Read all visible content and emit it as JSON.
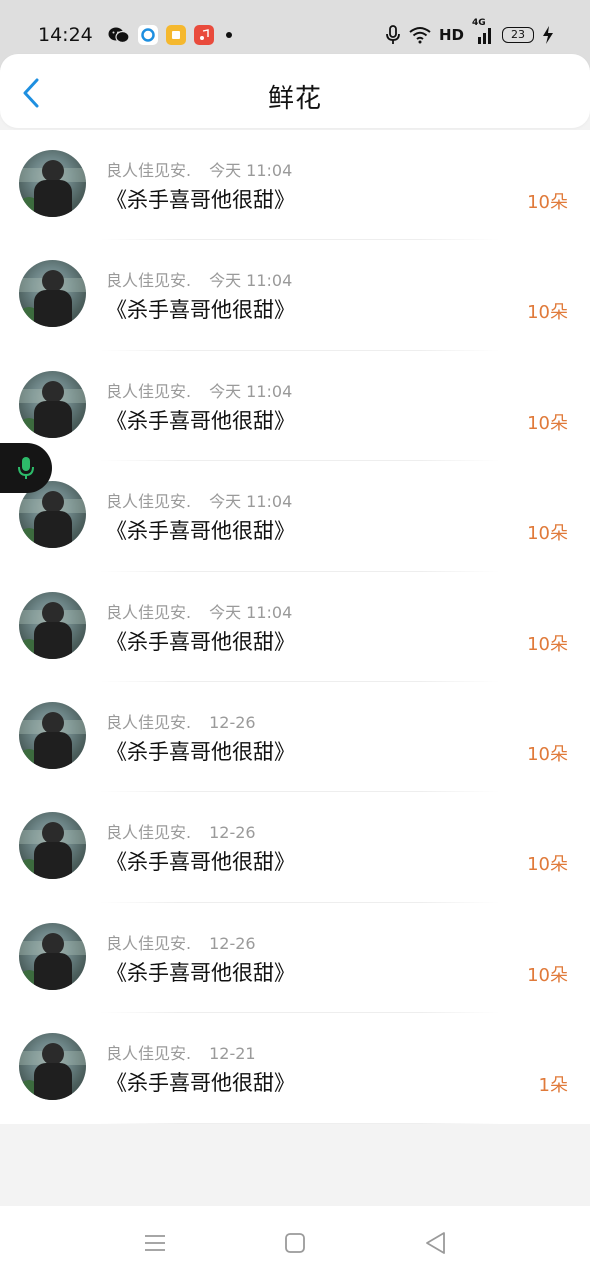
{
  "status_bar": {
    "time": "14:24",
    "network": "HD",
    "signal": "4G",
    "battery": "23",
    "icons": [
      "wechat-icon",
      "qq-browser-icon",
      "books-icon",
      "music-icon",
      "dot-icon",
      "mic-icon",
      "wifi-icon",
      "signal-icon",
      "battery-icon",
      "charging-icon"
    ]
  },
  "header": {
    "title": "鲜花",
    "back_icon": "chevron-left-icon"
  },
  "list": [
    {
      "user": "良人佳见安.",
      "time": "今天 11:04",
      "book": "《杀手喜哥他很甜》",
      "amount": "10朵"
    },
    {
      "user": "良人佳见安.",
      "time": "今天 11:04",
      "book": "《杀手喜哥他很甜》",
      "amount": "10朵"
    },
    {
      "user": "良人佳见安.",
      "time": "今天 11:04",
      "book": "《杀手喜哥他很甜》",
      "amount": "10朵"
    },
    {
      "user": "良人佳见安.",
      "time": "今天 11:04",
      "book": "《杀手喜哥他很甜》",
      "amount": "10朵"
    },
    {
      "user": "良人佳见安.",
      "time": "今天 11:04",
      "book": "《杀手喜哥他很甜》",
      "amount": "10朵"
    },
    {
      "user": "良人佳见安.",
      "time": "12-26",
      "book": "《杀手喜哥他很甜》",
      "amount": "10朵"
    },
    {
      "user": "良人佳见安.",
      "time": "12-26",
      "book": "《杀手喜哥他很甜》",
      "amount": "10朵"
    },
    {
      "user": "良人佳见安.",
      "time": "12-26",
      "book": "《杀手喜哥他很甜》",
      "amount": "10朵"
    },
    {
      "user": "良人佳见安.",
      "time": "12-21",
      "book": "《杀手喜哥他很甜》",
      "amount": "1朵"
    }
  ],
  "floating": {
    "icon": "microphone-icon"
  },
  "nav": {
    "icons": [
      "menu-icon",
      "home-square-icon",
      "back-triangle-icon"
    ]
  },
  "colors": {
    "accent": "#e07a3a",
    "back": "#1e8fe0",
    "mic": "#2dbb6a"
  }
}
